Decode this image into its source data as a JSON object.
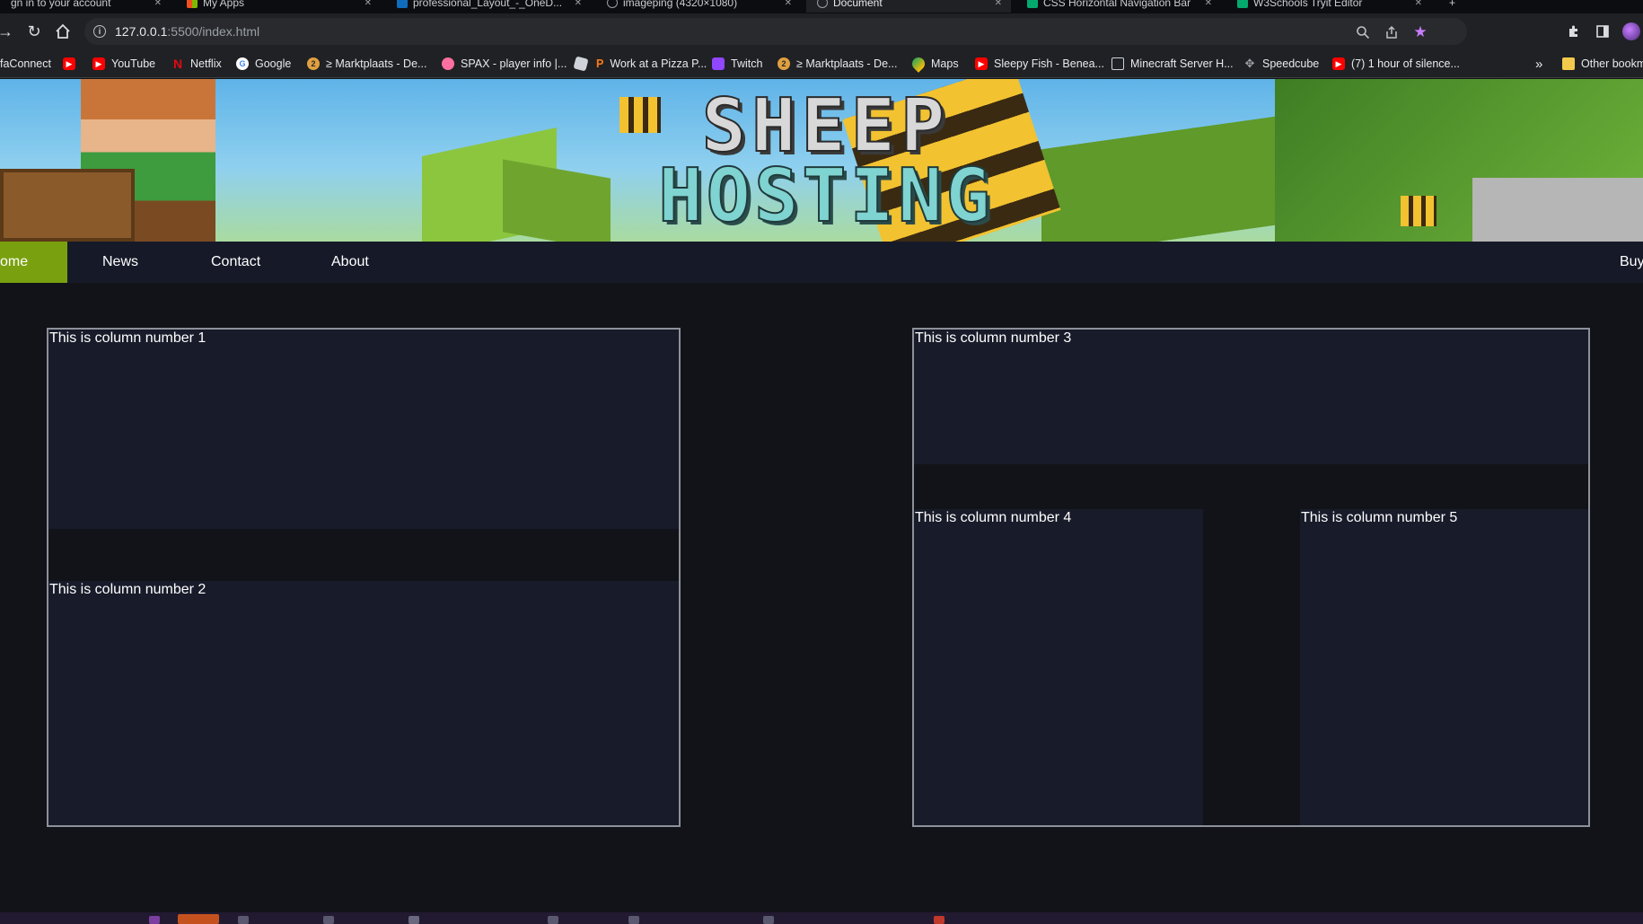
{
  "browser": {
    "tabs": [
      {
        "label": "gn in to your account"
      },
      {
        "label": "My Apps"
      },
      {
        "label": "professional_Layout_-_OneD..."
      },
      {
        "label": "imageping (4320×1080)"
      },
      {
        "label": "Document"
      },
      {
        "label": "CSS Horizontal Navigation Bar"
      },
      {
        "label": "W3Schools Tryit Editor"
      }
    ],
    "new_tab_label": "+",
    "url_host": "127.0.0.1",
    "url_rest": ":5500/index.html",
    "bookmarks": [
      {
        "label": "faConnect"
      },
      {
        "label": "YouTube"
      },
      {
        "label": "Netflix"
      },
      {
        "label": "Google"
      },
      {
        "label": "≥ Marktplaats - De..."
      },
      {
        "label": "SPAX - player info |..."
      },
      {
        "label": "Work at a Pizza P..."
      },
      {
        "label": "Twitch"
      },
      {
        "label": "≥ Marktplaats - De..."
      },
      {
        "label": "Maps"
      },
      {
        "label": "Sleepy Fish - Benea..."
      },
      {
        "label": "Minecraft Server H..."
      },
      {
        "label": "Speedcube"
      },
      {
        "label": "(7) 1 hour of silence..."
      }
    ],
    "bookmarks_overflow": "»",
    "other_bookmarks": "Other bookm"
  },
  "site": {
    "banner": {
      "line1": "SHEEP",
      "line2": "HOSTING"
    },
    "nav": {
      "home": "ome",
      "news": "News",
      "contact": "Contact",
      "about": "About",
      "buy": "Buy"
    },
    "columns": {
      "col1": "This is column number 1",
      "col2": "This is column number 2",
      "col3": "This is column number 3",
      "col4": "This is column number 4",
      "col5": "This is column number 5"
    }
  },
  "colors": {
    "page_bg": "#111318",
    "navbar_bg": "#161a28",
    "nav_active": "#79a10f",
    "column_bg": "#181b29",
    "frame_border": "#8c9099"
  }
}
